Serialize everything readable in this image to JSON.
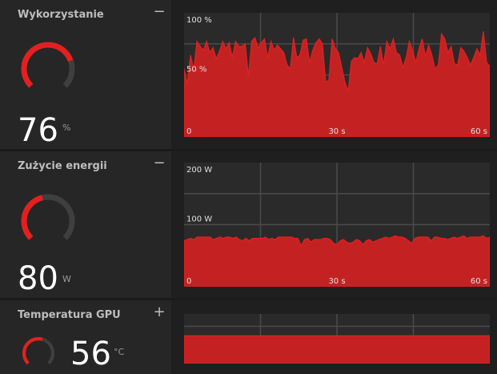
{
  "colors": {
    "accent": "#e3201f",
    "fill": "#c42222",
    "grid": "#4a4a4a",
    "track": "#3f3f3f"
  },
  "panels": [
    {
      "title": "Wykorzystanie",
      "toggle": "−",
      "value": "76",
      "unit": "%",
      "gauge_fraction": 0.76,
      "y_labels": [
        "100 %",
        "50 %"
      ],
      "x_labels": [
        "0",
        "30 s",
        "60 s"
      ],
      "chart_data": {
        "type": "area",
        "ylim": [
          0,
          100
        ],
        "xlim": [
          0,
          60
        ],
        "values": [
          55,
          43,
          66,
          54,
          77,
          73,
          70,
          77,
          68,
          72,
          63,
          69,
          77,
          71,
          76,
          64,
          77,
          73,
          73,
          75,
          49,
          77,
          80,
          72,
          76,
          79,
          64,
          77,
          70,
          74,
          71,
          68,
          58,
          55,
          80,
          64,
          66,
          78,
          79,
          60,
          70,
          76,
          79,
          75,
          44,
          46,
          79,
          71,
          68,
          56,
          44,
          37,
          61,
          64,
          63,
          68,
          60,
          72,
          67,
          60,
          59,
          73,
          58,
          77,
          71,
          79,
          68,
          66,
          56,
          64,
          77,
          70,
          60,
          71,
          79,
          65,
          74,
          66,
          55,
          58,
          83,
          79,
          68,
          73,
          59,
          58,
          72,
          69,
          64,
          58,
          64,
          71,
          66,
          85,
          60,
          57
        ]
      },
      "y_label_pos": [
        100,
        50
      ]
    },
    {
      "title": "Zużycie energii",
      "toggle": "−",
      "value": "80",
      "unit": "W",
      "gauge_fraction": 0.45,
      "y_labels": [
        "200 W",
        "100 W"
      ],
      "x_labels": [
        "0",
        "30 s",
        "60 s"
      ],
      "chart_data": {
        "type": "area",
        "ylim": [
          0,
          200
        ],
        "xlim": [
          0,
          60
        ],
        "values": [
          74,
          76,
          78,
          76,
          80,
          80,
          80,
          80,
          80,
          76,
          78,
          80,
          78,
          80,
          80,
          78,
          80,
          76,
          74,
          78,
          74,
          78,
          78,
          78,
          78,
          80,
          76,
          78,
          76,
          80,
          80,
          80,
          80,
          80,
          78,
          78,
          66,
          76,
          78,
          72,
          76,
          76,
          76,
          78,
          78,
          76,
          70,
          68,
          74,
          76,
          72,
          70,
          72,
          76,
          74,
          68,
          74,
          76,
          72,
          74,
          76,
          78,
          80,
          78,
          80,
          82,
          80,
          80,
          78,
          74,
          70,
          78,
          80,
          80,
          80,
          80,
          74,
          80,
          80,
          78,
          78,
          76,
          78,
          80,
          78,
          80,
          82,
          78,
          80,
          80,
          80,
          80,
          82,
          78,
          80
        ]
      },
      "y_label_pos": [
        200,
        100
      ]
    },
    {
      "title": "Temperatura GPU",
      "toggle": "+",
      "value": "56",
      "unit": "°C",
      "gauge_fraction": 0.56,
      "chart_data": {
        "type": "area",
        "ylim": [
          0,
          100
        ],
        "xlim": [
          0,
          60
        ],
        "values": [
          56,
          56,
          56,
          56,
          56,
          56,
          56,
          56,
          56,
          56,
          56,
          56,
          56,
          56,
          56,
          56,
          56,
          56,
          56,
          56,
          56,
          56,
          56,
          56,
          56,
          56,
          56,
          56,
          56,
          56,
          56,
          56,
          56,
          56,
          56,
          56,
          56,
          56,
          56,
          56,
          56,
          56,
          56,
          56,
          56,
          56,
          56,
          56,
          56,
          56,
          56,
          56,
          56,
          56,
          56,
          56,
          56,
          56,
          56,
          56,
          56
        ]
      }
    }
  ]
}
